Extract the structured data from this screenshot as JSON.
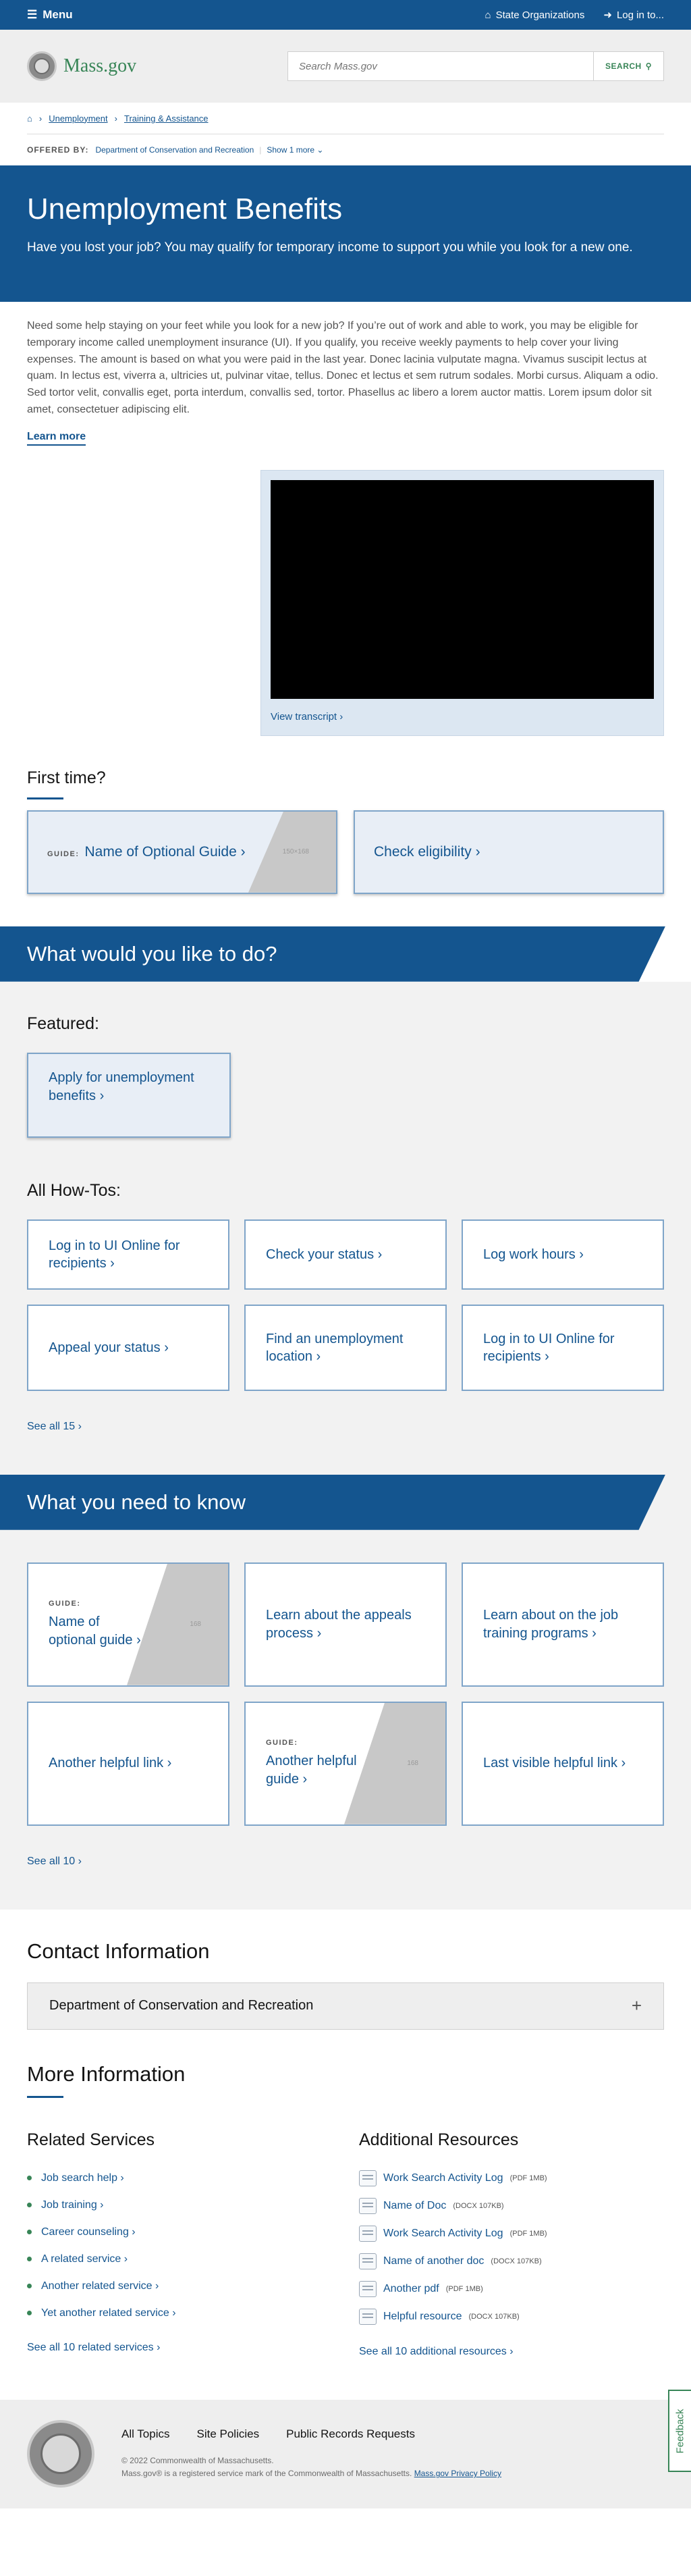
{
  "topbar": {
    "menu": "Menu",
    "state_orgs": "State Organizations",
    "login": "Log in to..."
  },
  "header": {
    "logo_text": "Mass.gov",
    "search_placeholder": "Search Mass.gov",
    "search_button": "SEARCH"
  },
  "breadcrumb": {
    "items": [
      "Unemployment",
      "Training & Assistance"
    ]
  },
  "offered_by": {
    "label": "OFFERED BY:",
    "org": "Department of Conservation and Recreation",
    "more": "Show 1 more"
  },
  "banner": {
    "title": "Unemployment Benefits",
    "subtitle": "Have you lost your job? You may qualify for temporary income to support you while you look for a new one."
  },
  "intro": {
    "text": "Need some help staying on your feet while you look for a new job? If you’re out of work and able to work, you may be eligible for temporary income called unemployment insurance (UI). If you qualify, you receive weekly payments to help cover your living expenses. The amount is based on what you were paid in the last year. Donec lacinia vulputate magna. Vivamus suscipit lectus at quam. In lectus est, viverra a, ultricies ut, pulvinar vitae, tellus. Donec et lectus et sem rutrum sodales. Morbi cursus. Aliquam a odio. Sed tortor velit, convallis eget, porta interdum, convallis sed, tortor. Phasellus ac libero a lorem auctor mattis. Lorem ipsum dolor sit amet, consectetuer adipiscing elit.",
    "learn_more": "Learn more"
  },
  "video": {
    "transcript": "View transcript"
  },
  "first_time": {
    "title": "First time?",
    "guide_tag": "GUIDE:",
    "guide_title": "Name of Optional Guide",
    "guide_img": "150×168",
    "check": "Check eligibility"
  },
  "what_to_do": {
    "title": "What would you like to do?",
    "featured_label": "Featured:",
    "featured": "Apply for unemployment benefits",
    "all_label": "All How-Tos:",
    "howtos": [
      "Log in to UI Online for recipients",
      "Check your status",
      "Log work hours",
      "Appeal your status",
      "Find an unemployment location",
      "Log in to UI Online for recipients"
    ],
    "see_all": "See all 15"
  },
  "need_to_know": {
    "title": "What you need to know",
    "guide_tag": "GUIDE:",
    "img_label": "168",
    "cards": [
      "Name of optional guide",
      "Learn about the appeals process",
      "Learn about on the job training programs",
      "Another helpful link",
      "Another helpful guide",
      "Last visible helpful link"
    ],
    "see_all": "See all 10"
  },
  "contact": {
    "title": "Contact Information",
    "org": "Department of Conservation and Recreation"
  },
  "more_info": {
    "title": "More Information",
    "related_title": "Related Services",
    "related": [
      "Job search help",
      "Job training",
      "Career counseling",
      "A related service",
      "Another related service",
      "Yet another related service"
    ],
    "related_see_all": "See all 10 related services",
    "additional_title": "Additional Resources",
    "resources": [
      {
        "name": "Work Search Activity Log",
        "meta": "(PDF 1MB)"
      },
      {
        "name": "Name of Doc",
        "meta": "(DOCX 107KB)"
      },
      {
        "name": "Work Search Activity Log",
        "meta": "(PDF 1MB)"
      },
      {
        "name": "Name of another doc",
        "meta": "(DOCX 107KB)"
      },
      {
        "name": "Another pdf",
        "meta": "(PDF 1MB)"
      },
      {
        "name": "Helpful resource",
        "meta": "(DOCX 107KB)"
      }
    ],
    "additional_see_all": "See all 10 additional resources"
  },
  "footer": {
    "links": [
      "All Topics",
      "Site Policies",
      "Public Records Requests"
    ],
    "copyright": "© 2022 Commonwealth of Massachusetts.",
    "trademark": "Mass.gov® is a registered service mark of the Commonwealth of Massachusetts.",
    "privacy": "Mass.gov Privacy Policy"
  },
  "feedback": "Feedback",
  "colors": {
    "primary": "#14558f",
    "green": "#388557",
    "gray_bg": "#f2f2f2"
  }
}
